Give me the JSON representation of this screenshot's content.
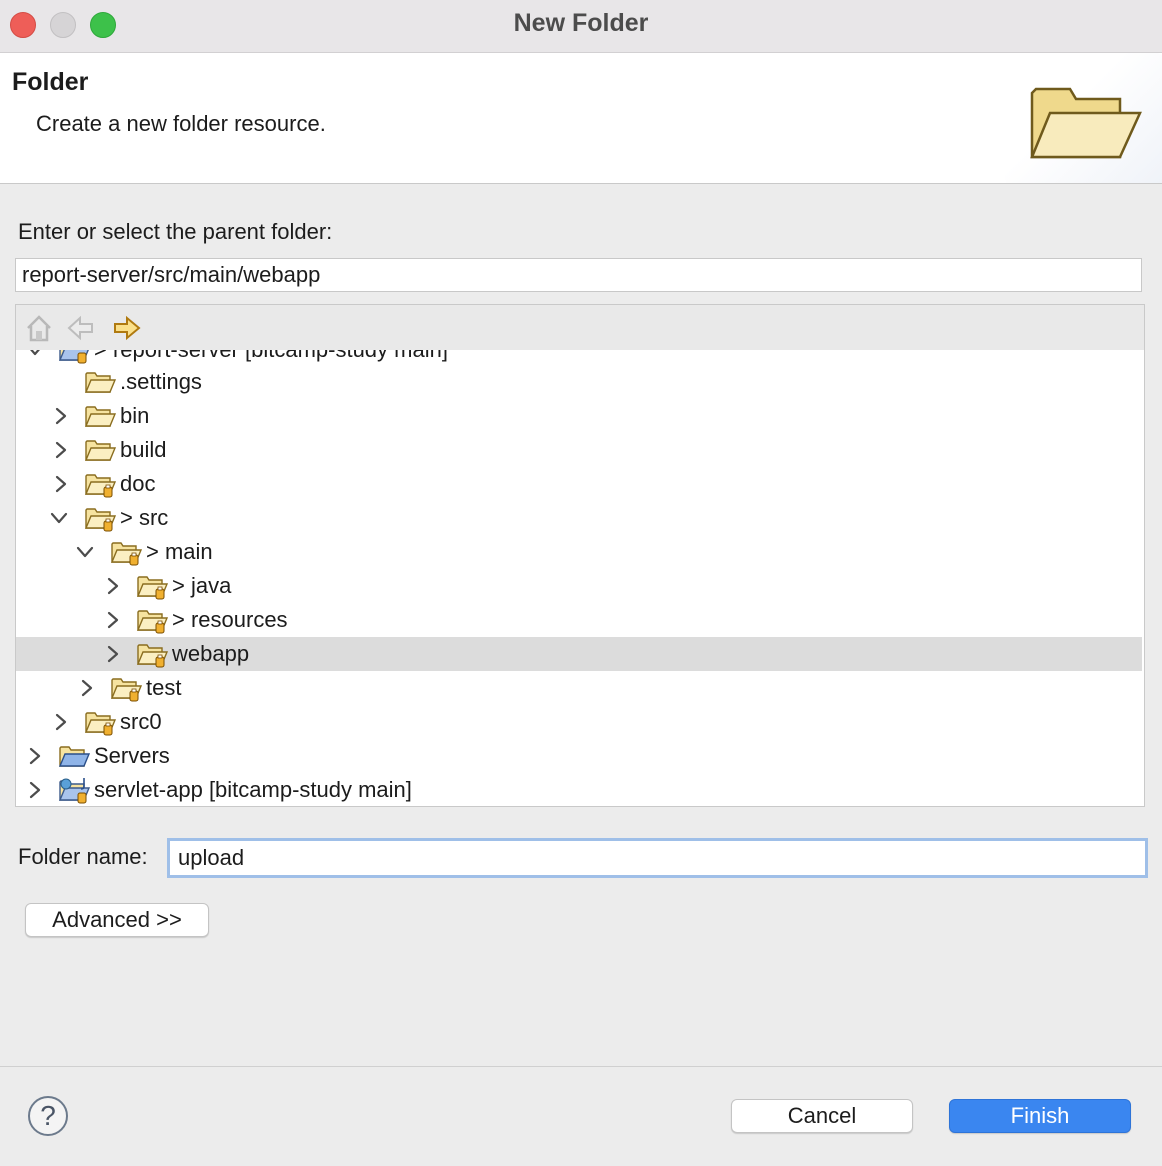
{
  "window": {
    "title": "New Folder"
  },
  "banner": {
    "title": "Folder",
    "description": "Create a new folder resource.",
    "icon": "open-folder-icon"
  },
  "parent": {
    "label": "Enter or select the parent folder:",
    "path": "report-server/src/main/webapp"
  },
  "toolbar": {
    "home": "home-icon",
    "back": "back-arrow-icon",
    "forward": "forward-arrow-icon"
  },
  "tree": {
    "items": [
      {
        "label": "> report-server [bitcamp-study main]",
        "expanded": true
      },
      {
        "label": ".settings"
      },
      {
        "label": "bin"
      },
      {
        "label": "build"
      },
      {
        "label": "doc"
      },
      {
        "label": "> src",
        "expanded": true
      },
      {
        "label": "> main",
        "expanded": true
      },
      {
        "label": "> java"
      },
      {
        "label": "> resources"
      },
      {
        "label": "webapp",
        "selected": true
      },
      {
        "label": "test"
      },
      {
        "label": "src0"
      },
      {
        "label": "Servers"
      },
      {
        "label": "servlet-app [bitcamp-study main]"
      }
    ]
  },
  "folder_name": {
    "label": "Folder name:",
    "value": "upload"
  },
  "buttons": {
    "advanced": "Advanced >>",
    "cancel": "Cancel",
    "finish": "Finish",
    "help": "?"
  },
  "colors": {
    "accent": "#3a86f0",
    "selection": "#dcdcdc",
    "folder": "#f5e6a8"
  }
}
